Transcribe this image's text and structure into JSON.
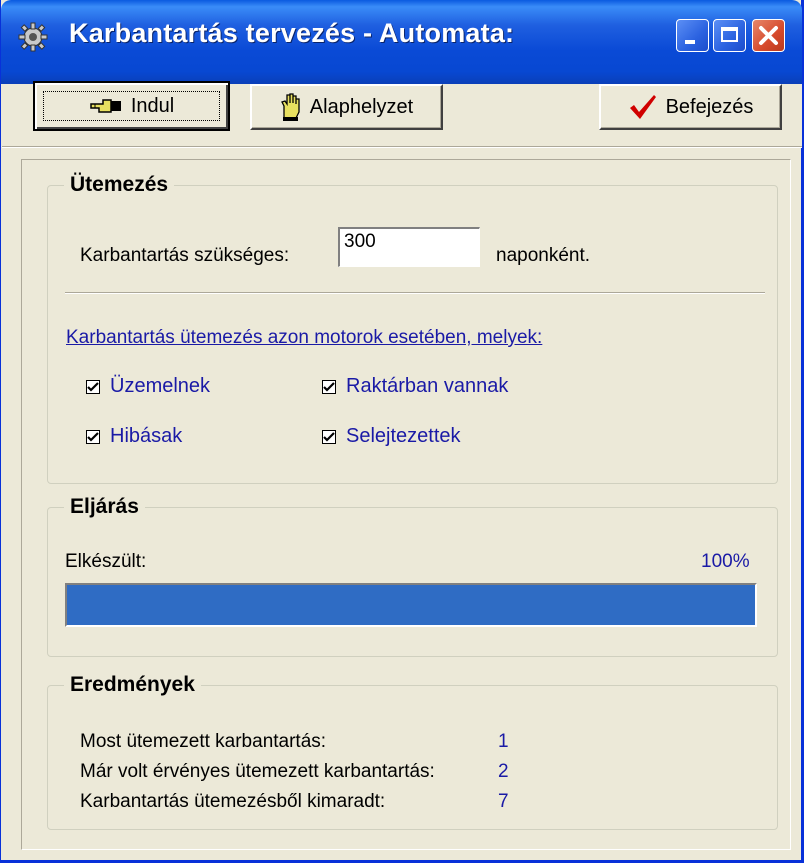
{
  "window": {
    "title": "Karbantartás tervezés - Automata:"
  },
  "toolbar": {
    "indul": "Indul",
    "alaphelyzet": "Alaphelyzet",
    "befejezes": "Befejezés"
  },
  "utemezes": {
    "legend": "Ütemezés",
    "label": "Karbantartás szükséges:",
    "value": "300",
    "unit": "naponként.",
    "link": "Karbantartás ütemezés azon motorok esetében, melyek:",
    "checkboxes": [
      {
        "label": "Üzemelnek",
        "checked": true
      },
      {
        "label": "Raktárban vannak",
        "checked": true
      },
      {
        "label": "Hibásak",
        "checked": true
      },
      {
        "label": "Selejtezettek",
        "checked": true
      }
    ]
  },
  "eljaras": {
    "legend": "Eljárás",
    "label": "Elkészült:",
    "percent_text": "100%",
    "progress": 1.0
  },
  "eredmenyek": {
    "legend": "Eredmények",
    "rows": [
      {
        "label": "Most ütemezett karbantartás:",
        "value": "1"
      },
      {
        "label": "Már volt érvényes ütemezett karbantartás:",
        "value": "2"
      },
      {
        "label": "Karbantartás ütemezésből kimaradt:",
        "value": "7"
      }
    ]
  },
  "colors": {
    "titlebar": "#0a4ad6",
    "progress": "#2f6cc4",
    "value_text": "#1a1aa6",
    "check_mark": "#d00000"
  },
  "icons": [
    "gear-icon",
    "hand-pointing-icon",
    "hand-icon",
    "checkmark-icon",
    "minimize-icon",
    "maximize-icon",
    "close-icon"
  ]
}
